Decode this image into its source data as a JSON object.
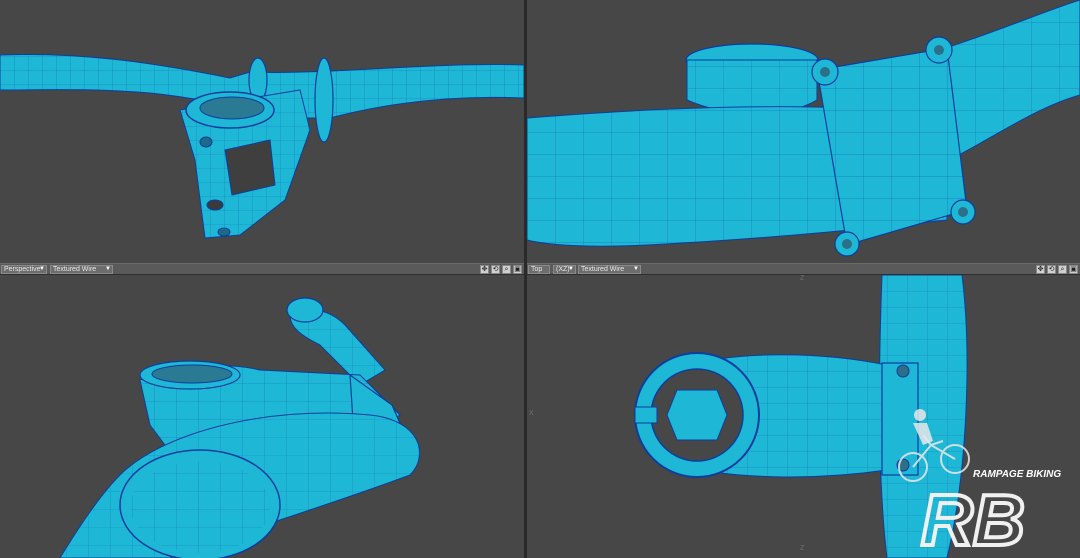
{
  "viewports": {
    "bottom_left_toolbar": {
      "view_mode": "Perspective",
      "render_mode": "Textured Wire"
    },
    "bottom_right_toolbar": {
      "view_mode": "Top",
      "axis_mode": "(XZ)",
      "render_mode": "Textured Wire"
    }
  },
  "axis_labels": {
    "z_top": "Z",
    "z_bottom": "Z",
    "x_left": "X"
  },
  "icons": {
    "move": "move-icon",
    "rotate": "rotate-icon",
    "zoom": "zoom-icon",
    "maximize": "maximize-icon"
  },
  "watermark": {
    "brand_text": "RAMPAGE BIKING",
    "initials": "RB"
  },
  "colors": {
    "viewport_bg": "#474747",
    "model_fill": "#1fb7d6",
    "wire": "#0a3fa0",
    "toolbar_bg": "#5a5a5a"
  }
}
